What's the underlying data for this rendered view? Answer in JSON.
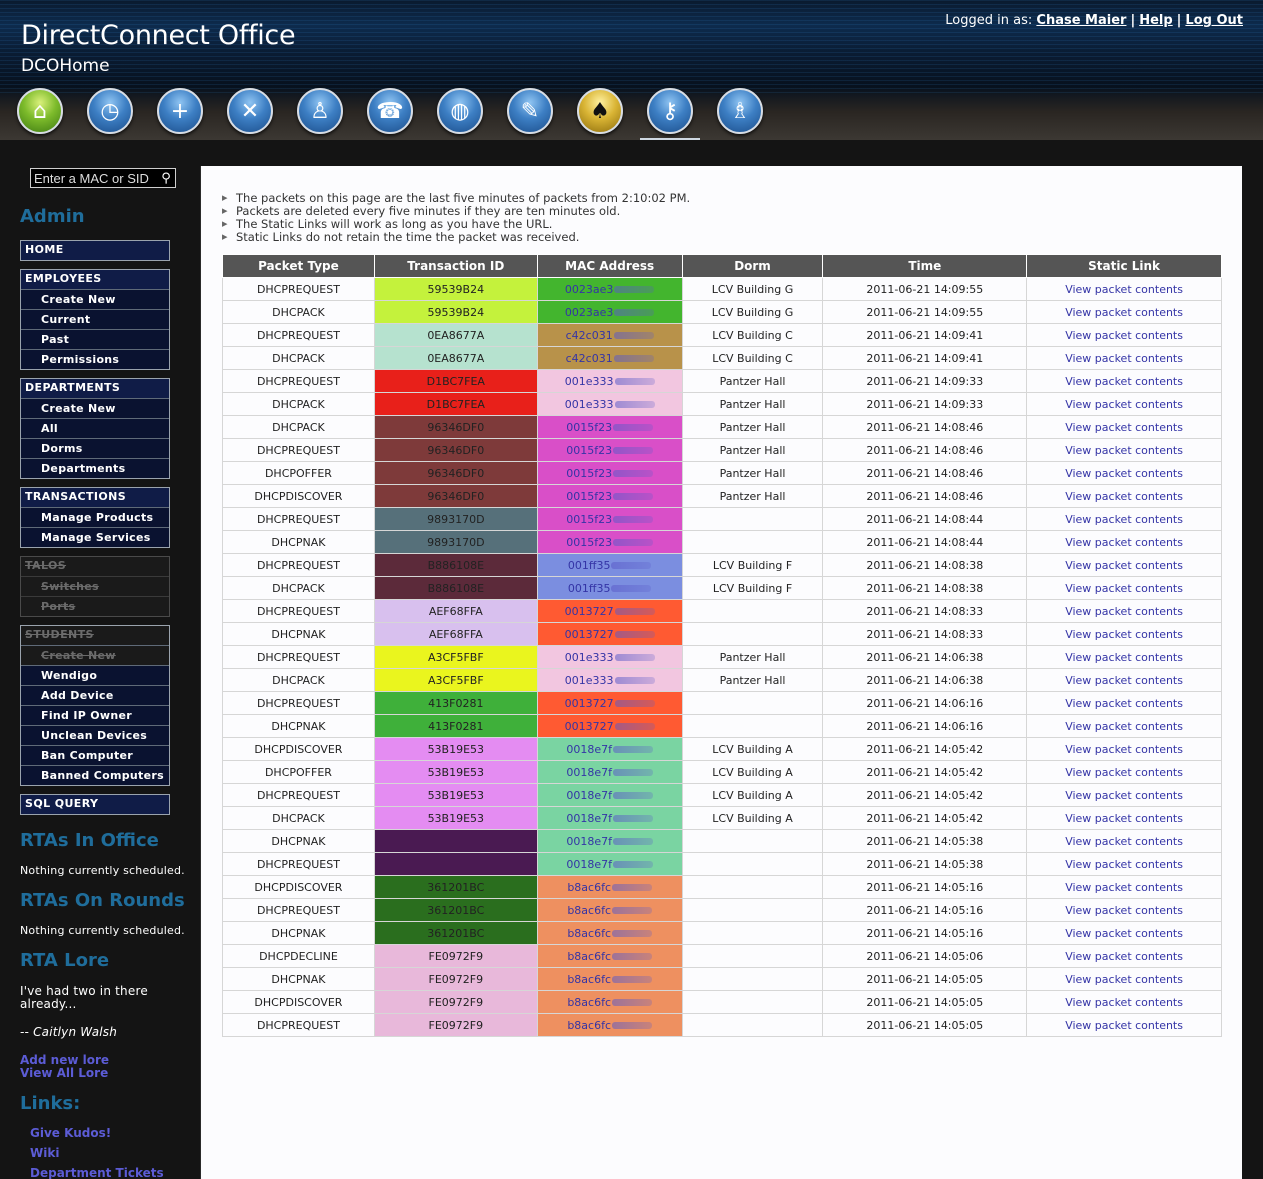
{
  "header": {
    "app_title": "DirectConnect Office",
    "app_subtitle": "DCOHome",
    "login_prefix": "Logged in as:",
    "user_name": "Chase Maier",
    "help_label": "Help",
    "logout_label": "Log Out"
  },
  "nav_icons": [
    {
      "name": "home-icon",
      "glyph": "⌂",
      "color": "green"
    },
    {
      "name": "clock-icon",
      "glyph": "◷",
      "color": "blue"
    },
    {
      "name": "add-icon",
      "glyph": "+",
      "color": "blue"
    },
    {
      "name": "tools-icon",
      "glyph": "✕",
      "color": "blue"
    },
    {
      "name": "people-icon",
      "glyph": "♙",
      "color": "blue"
    },
    {
      "name": "phone-icon",
      "glyph": "☎",
      "color": "blue"
    },
    {
      "name": "globe-icon",
      "glyph": "◍",
      "color": "blue"
    },
    {
      "name": "pen-icon",
      "glyph": "✎",
      "color": "blue"
    },
    {
      "name": "spade-icon",
      "glyph": "♠",
      "color": "gold"
    },
    {
      "name": "key-icon",
      "glyph": "⚷",
      "color": "blue"
    },
    {
      "name": "group-icon",
      "glyph": "♗",
      "color": "blue"
    }
  ],
  "sidebar": {
    "search_placeholder": "Enter a MAC or SID",
    "admin_heading": "Admin",
    "home_label": "HOME",
    "employees": {
      "header": "EMPLOYEES",
      "items": [
        "Create New",
        "Current",
        "Past",
        "Permissions"
      ]
    },
    "departments": {
      "header": "DEPARTMENTS",
      "items": [
        "Create New",
        "All",
        "Dorms",
        "Departments"
      ]
    },
    "transactions": {
      "header": "TRANSACTIONS",
      "items": [
        "Manage Products",
        "Manage Services"
      ]
    },
    "talos": {
      "header": "TALOS",
      "items": [
        "Switches",
        "Ports"
      ]
    },
    "students": {
      "header": "STUDENTS",
      "items": [
        "Create New",
        "Wendigo",
        "Add Device",
        "Find IP Owner",
        "Unclean Devices",
        "Ban Computer",
        "Banned Computers"
      ]
    },
    "sql_label": "SQL QUERY",
    "rtas_in_office_heading": "RTAs In Office",
    "rtas_in_office_text": "Nothing currently scheduled.",
    "rtas_on_rounds_heading": "RTAs On Rounds",
    "rtas_on_rounds_text": "Nothing currently scheduled.",
    "rta_lore_heading": "RTA Lore",
    "lore_quote_line1": "I've had two in there",
    "lore_quote_line2": "already...",
    "lore_author": "-- Caitlyn Walsh",
    "add_lore": "Add new lore",
    "view_lore": "View All Lore",
    "links_heading": "Links:",
    "links": [
      "Give Kudos!",
      "Wiki",
      "Department Tickets"
    ]
  },
  "notes": [
    "The packets on this page are the last five minutes of packets from 2:10:02 PM.",
    "Packets are deleted every five minutes if they are ten minutes old.",
    "The Static Links will work as long as you have the URL.",
    "Static Links do not retain the time the packet was received."
  ],
  "table": {
    "columns": [
      "Packet Type",
      "Transaction ID",
      "MAC Address",
      "Dorm",
      "Time",
      "Static Link"
    ],
    "link_label": "View packet contents",
    "rows": [
      {
        "type": "DHCPREQUEST",
        "tid": "59539B24",
        "tid_color": "#c4f23c",
        "mac": "0023ae3",
        "mac_color": "#43b52e",
        "dorm": "LCV Building G",
        "time": "2011-06-21 14:09:55"
      },
      {
        "type": "DHCPACK",
        "tid": "59539B24",
        "tid_color": "#c4f23c",
        "mac": "0023ae3",
        "mac_color": "#43b52e",
        "dorm": "LCV Building G",
        "time": "2011-06-21 14:09:55"
      },
      {
        "type": "DHCPREQUEST",
        "tid": "0EA8677A",
        "tid_color": "#b6e2cf",
        "mac": "c42c031",
        "mac_color": "#b8924a",
        "dorm": "LCV Building C",
        "time": "2011-06-21 14:09:41"
      },
      {
        "type": "DHCPACK",
        "tid": "0EA8677A",
        "tid_color": "#b6e2cf",
        "mac": "c42c031",
        "mac_color": "#b8924a",
        "dorm": "LCV Building C",
        "time": "2011-06-21 14:09:41"
      },
      {
        "type": "DHCPREQUEST",
        "tid": "D1BC7FEA",
        "tid_color": "#e8201a",
        "mac": "001e333",
        "mac_color": "#f2c6e0",
        "dorm": "Pantzer Hall",
        "time": "2011-06-21 14:09:33"
      },
      {
        "type": "DHCPACK",
        "tid": "D1BC7FEA",
        "tid_color": "#e8201a",
        "mac": "001e333",
        "mac_color": "#f2c6e0",
        "dorm": "Pantzer Hall",
        "time": "2011-06-21 14:09:33"
      },
      {
        "type": "DHCPACK",
        "tid": "96346DF0",
        "tid_color": "#7e3a3a",
        "mac": "0015f23",
        "mac_color": "#d94fc8",
        "dorm": "Pantzer Hall",
        "time": "2011-06-21 14:08:46"
      },
      {
        "type": "DHCPREQUEST",
        "tid": "96346DF0",
        "tid_color": "#7e3a3a",
        "mac": "0015f23",
        "mac_color": "#d94fc8",
        "dorm": "Pantzer Hall",
        "time": "2011-06-21 14:08:46"
      },
      {
        "type": "DHCPOFFER",
        "tid": "96346DF0",
        "tid_color": "#7e3a3a",
        "mac": "0015f23",
        "mac_color": "#d94fc8",
        "dorm": "Pantzer Hall",
        "time": "2011-06-21 14:08:46"
      },
      {
        "type": "DHCPDISCOVER",
        "tid": "96346DF0",
        "tid_color": "#7e3a3a",
        "mac": "0015f23",
        "mac_color": "#d94fc8",
        "dorm": "Pantzer Hall",
        "time": "2011-06-21 14:08:46"
      },
      {
        "type": "DHCPREQUEST",
        "tid": "9893170D",
        "tid_color": "#56707a",
        "mac": "0015f23",
        "mac_color": "#d94fc8",
        "dorm": "",
        "time": "2011-06-21 14:08:44"
      },
      {
        "type": "DHCPNAK",
        "tid": "9893170D",
        "tid_color": "#56707a",
        "mac": "0015f23",
        "mac_color": "#d94fc8",
        "dorm": "",
        "time": "2011-06-21 14:08:44"
      },
      {
        "type": "DHCPREQUEST",
        "tid": "B886108E",
        "tid_color": "#5c2a3a",
        "mac": "001ff35",
        "mac_color": "#7b8ee0",
        "dorm": "LCV Building F",
        "time": "2011-06-21 14:08:38"
      },
      {
        "type": "DHCPACK",
        "tid": "B886108E",
        "tid_color": "#5c2a3a",
        "mac": "001ff35",
        "mac_color": "#7b8ee0",
        "dorm": "LCV Building F",
        "time": "2011-06-21 14:08:38"
      },
      {
        "type": "DHCPREQUEST",
        "tid": "AEF68FFA",
        "tid_color": "#d8c0ee",
        "mac": "0013727",
        "mac_color": "#ff5a32",
        "dorm": "",
        "time": "2011-06-21 14:08:33"
      },
      {
        "type": "DHCPNAK",
        "tid": "AEF68FFA",
        "tid_color": "#d8c0ee",
        "mac": "0013727",
        "mac_color": "#ff5a32",
        "dorm": "",
        "time": "2011-06-21 14:08:33"
      },
      {
        "type": "DHCPREQUEST",
        "tid": "A3CF5FBF",
        "tid_color": "#eaf51e",
        "mac": "001e333",
        "mac_color": "#f2c6e0",
        "dorm": "Pantzer Hall",
        "time": "2011-06-21 14:06:38"
      },
      {
        "type": "DHCPACK",
        "tid": "A3CF5FBF",
        "tid_color": "#eaf51e",
        "mac": "001e333",
        "mac_color": "#f2c6e0",
        "dorm": "Pantzer Hall",
        "time": "2011-06-21 14:06:38"
      },
      {
        "type": "DHCPREQUEST",
        "tid": "413F0281",
        "tid_color": "#3fb03a",
        "mac": "0013727",
        "mac_color": "#ff5a32",
        "dorm": "",
        "time": "2011-06-21 14:06:16"
      },
      {
        "type": "DHCPNAK",
        "tid": "413F0281",
        "tid_color": "#3fb03a",
        "mac": "0013727",
        "mac_color": "#ff5a32",
        "dorm": "",
        "time": "2011-06-21 14:06:16"
      },
      {
        "type": "DHCPDISCOVER",
        "tid": "53B19E53",
        "tid_color": "#e48cf2",
        "mac": "0018e7f",
        "mac_color": "#7ad4a2",
        "dorm": "LCV Building A",
        "time": "2011-06-21 14:05:42"
      },
      {
        "type": "DHCPOFFER",
        "tid": "53B19E53",
        "tid_color": "#e48cf2",
        "mac": "0018e7f",
        "mac_color": "#7ad4a2",
        "dorm": "LCV Building A",
        "time": "2011-06-21 14:05:42"
      },
      {
        "type": "DHCPREQUEST",
        "tid": "53B19E53",
        "tid_color": "#e48cf2",
        "mac": "0018e7f",
        "mac_color": "#7ad4a2",
        "dorm": "LCV Building A",
        "time": "2011-06-21 14:05:42"
      },
      {
        "type": "DHCPACK",
        "tid": "53B19E53",
        "tid_color": "#e48cf2",
        "mac": "0018e7f",
        "mac_color": "#7ad4a2",
        "dorm": "LCV Building A",
        "time": "2011-06-21 14:05:42"
      },
      {
        "type": "DHCPNAK",
        "tid": "",
        "tid_color": "#4a1a52",
        "mac": "0018e7f",
        "mac_color": "#7ad4a2",
        "dorm": "",
        "time": "2011-06-21 14:05:38"
      },
      {
        "type": "DHCPREQUEST",
        "tid": "",
        "tid_color": "#4a1a52",
        "mac": "0018e7f",
        "mac_color": "#7ad4a2",
        "dorm": "",
        "time": "2011-06-21 14:05:38"
      },
      {
        "type": "DHCPDISCOVER",
        "tid": "361201BC",
        "tid_color": "#2a6e1e",
        "mac": "b8ac6fc",
        "mac_color": "#ee9060",
        "dorm": "",
        "time": "2011-06-21 14:05:16"
      },
      {
        "type": "DHCPREQUEST",
        "tid": "361201BC",
        "tid_color": "#2a6e1e",
        "mac": "b8ac6fc",
        "mac_color": "#ee9060",
        "dorm": "",
        "time": "2011-06-21 14:05:16"
      },
      {
        "type": "DHCPNAK",
        "tid": "361201BC",
        "tid_color": "#2a6e1e",
        "mac": "b8ac6fc",
        "mac_color": "#ee9060",
        "dorm": "",
        "time": "2011-06-21 14:05:16"
      },
      {
        "type": "DHCPDECLINE",
        "tid": "FE0972F9",
        "tid_color": "#e8b8da",
        "mac": "b8ac6fc",
        "mac_color": "#ee9060",
        "dorm": "",
        "time": "2011-06-21 14:05:06"
      },
      {
        "type": "DHCPNAK",
        "tid": "FE0972F9",
        "tid_color": "#e8b8da",
        "mac": "b8ac6fc",
        "mac_color": "#ee9060",
        "dorm": "",
        "time": "2011-06-21 14:05:05"
      },
      {
        "type": "DHCPDISCOVER",
        "tid": "FE0972F9",
        "tid_color": "#e8b8da",
        "mac": "b8ac6fc",
        "mac_color": "#ee9060",
        "dorm": "",
        "time": "2011-06-21 14:05:05"
      },
      {
        "type": "DHCPREQUEST",
        "tid": "FE0972F9",
        "tid_color": "#e8b8da",
        "mac": "b8ac6fc",
        "mac_color": "#ee9060",
        "dorm": "",
        "time": "2011-06-21 14:05:05"
      }
    ]
  }
}
